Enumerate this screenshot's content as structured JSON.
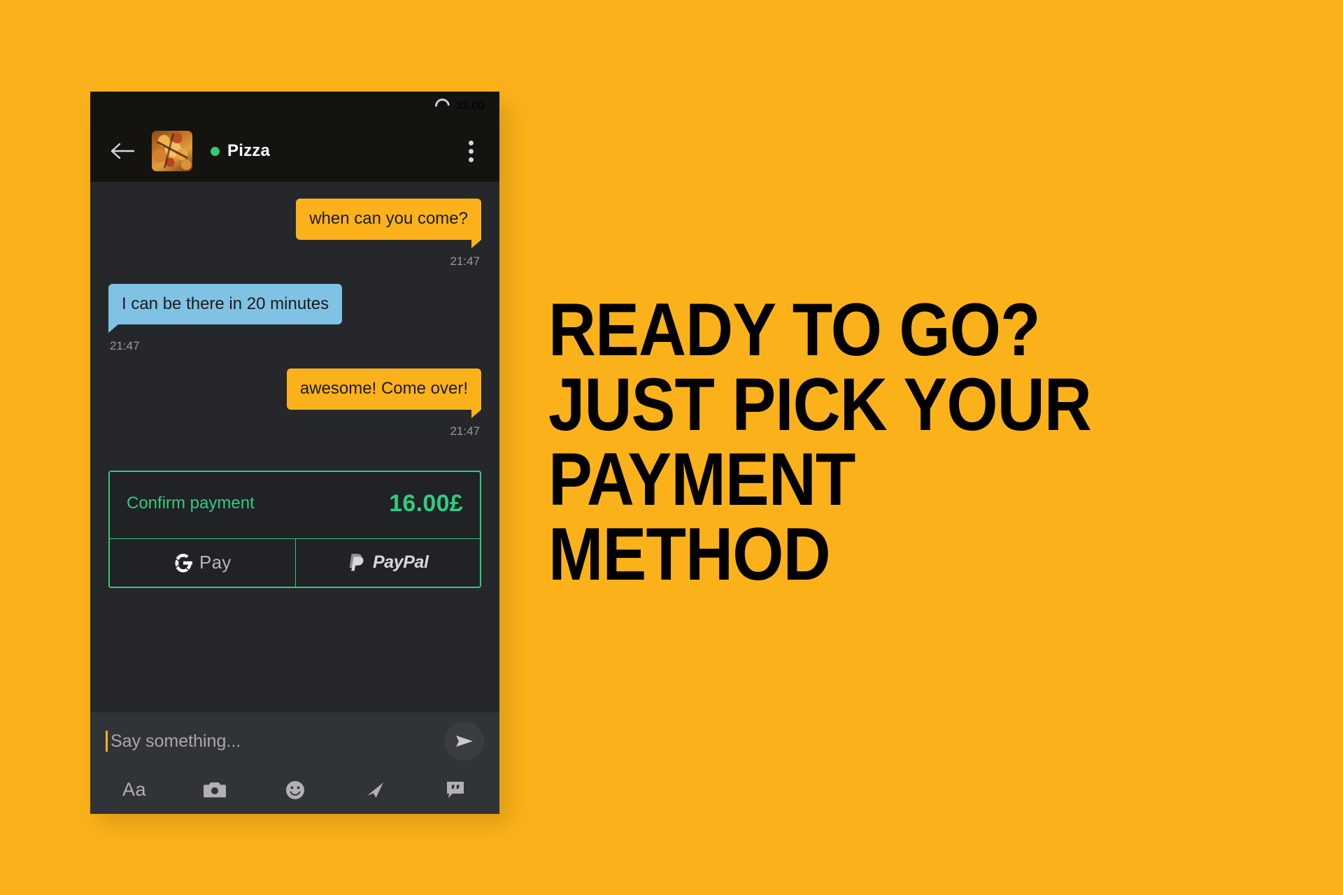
{
  "theme": {
    "brand_yellow": "#FBB21A",
    "bubble_out": "#FBB21A",
    "bubble_in": "#7FC2E4",
    "accent_green": "#2ECC80",
    "online_green": "#2ECC71",
    "app_bar_bg": "#141310",
    "thread_bg": "#26272A",
    "composer_bg": "#303338"
  },
  "phone": {
    "status_bar": {
      "time": "22:00",
      "icon": "loading-spinner-icon"
    },
    "app_bar": {
      "back_icon": "back-arrow-icon",
      "avatar_alt": "pizza-photo",
      "online_status": "online",
      "contact_name": "Pizza",
      "overflow_icon": "more-vertical-icon"
    },
    "messages": [
      {
        "id": "msg-1",
        "direction": "outgoing",
        "text": "when can you come?",
        "time": "21:47"
      },
      {
        "id": "msg-2",
        "direction": "incoming",
        "text": "I can be there in 20 minutes",
        "time": "21:47"
      },
      {
        "id": "msg-3",
        "direction": "outgoing",
        "text": "awesome! Come over!",
        "time": "21:47"
      }
    ],
    "payment_card": {
      "label": "Confirm payment",
      "amount": "16.00£",
      "methods": [
        {
          "id": "gpay",
          "icon": "google-g-icon",
          "label": "Pay"
        },
        {
          "id": "paypal",
          "icon": "paypal-p-icon",
          "label": "PayPal"
        }
      ]
    },
    "composer": {
      "placeholder": "Say something...",
      "value": "",
      "send_icon": "send-icon",
      "tools": [
        {
          "id": "format",
          "icon": "text-format-icon",
          "label": "Aa"
        },
        {
          "id": "camera",
          "icon": "camera-icon",
          "label": ""
        },
        {
          "id": "emoji",
          "icon": "smiley-icon",
          "label": ""
        },
        {
          "id": "location",
          "icon": "location-arrow-icon",
          "label": ""
        },
        {
          "id": "sticker",
          "icon": "quote-bubble-icon",
          "label": ""
        }
      ]
    }
  },
  "headline": {
    "line1": "READY TO GO?",
    "line2": "JUST PICK YOUR",
    "line3": "PAYMENT",
    "line4": "METHOD"
  }
}
